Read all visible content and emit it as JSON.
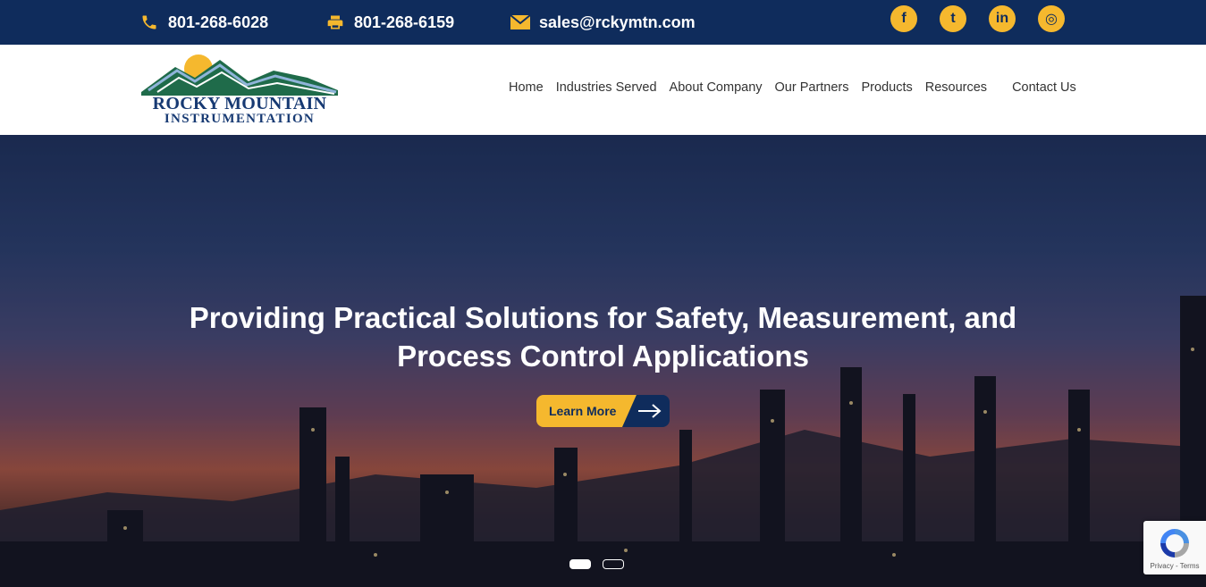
{
  "topbar": {
    "phone": "801-268-6028",
    "fax": "801-268-6159",
    "email": "sales@rckymtn.com",
    "socials": [
      {
        "icon": "facebook-icon",
        "glyph": "f"
      },
      {
        "icon": "tumblr-icon",
        "glyph": "t"
      },
      {
        "icon": "linkedin-icon",
        "glyph": "in"
      },
      {
        "icon": "instagram-icon",
        "glyph": "◎"
      }
    ]
  },
  "header": {
    "logo_line1": "ROCKY MOUNTAIN",
    "logo_line2": "INSTRUMENTATION",
    "nav": [
      "Home",
      "Industries Served",
      "About Company",
      "Our Partners",
      "Products",
      "Resources",
      "Contact Us"
    ]
  },
  "hero": {
    "title_line1": "Providing Practical Solutions for Safety, Measurement, and",
    "title_line2": "Process Control Applications",
    "cta_label": "Learn More",
    "slides": 2,
    "active_slide": 1
  },
  "recaptcha": {
    "text": "Privacy - Terms"
  },
  "colors": {
    "navy": "#0f2c5c",
    "gold": "#f5b82e",
    "logo_green": "#1f6b4a",
    "logo_blue": "#173a73"
  }
}
